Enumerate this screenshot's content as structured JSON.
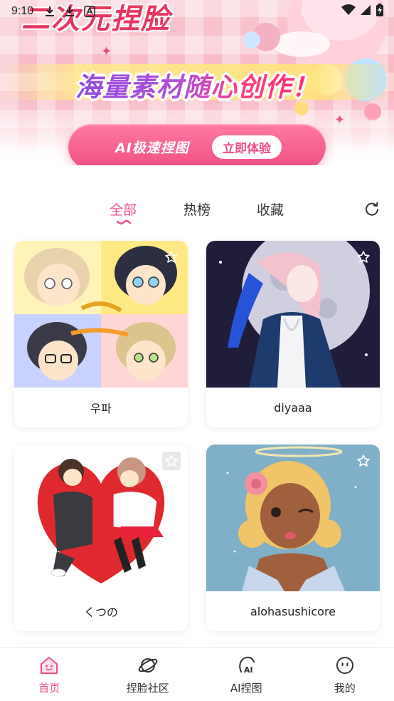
{
  "status_bar": {
    "time": "9:10",
    "left_icons": [
      "download-icon",
      "download-icon",
      "text-a-icon"
    ],
    "right_icons": [
      "wifi-icon",
      "signal-icon",
      "battery-charging-icon"
    ]
  },
  "banner": {
    "headline_top": "二次元捏脸",
    "headline_main": "海量素材随心创作！",
    "ai_pill_label": "AI极速捏图",
    "ai_pill_button": "立即体验"
  },
  "tabs": {
    "items": [
      "全部",
      "热榜",
      "收藏"
    ],
    "active_index": 0,
    "refresh_icon": "refresh-icon"
  },
  "cards": [
    {
      "title": "우파",
      "image": "chibi-group-illustration"
    },
    {
      "title": "diyaaa",
      "image": "moonlight-character-illustration"
    },
    {
      "title": "くつの",
      "image": "couple-heart-illustration"
    },
    {
      "title": "alohasushicore",
      "image": "winking-girl-illustration"
    }
  ],
  "bottom_nav": {
    "items": [
      {
        "label": "首页",
        "icon": "home-icon",
        "active": true
      },
      {
        "label": "捏脸社区",
        "icon": "planet-icon",
        "active": false
      },
      {
        "label": "AI捏图",
        "icon": "ai-face-icon",
        "active": false
      },
      {
        "label": "我的",
        "icon": "smiley-icon",
        "active": false
      }
    ]
  },
  "colors": {
    "accent": "#ef4f82",
    "text": "#333333"
  }
}
